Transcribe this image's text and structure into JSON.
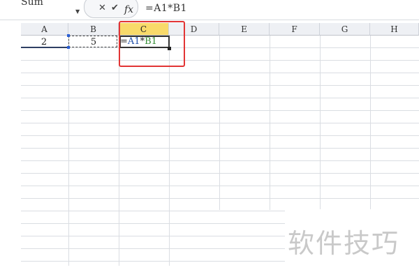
{
  "formula_bar": {
    "name_box": "Sum",
    "cancel_label": "✕",
    "enter_label": "✔",
    "fx_label": "fx",
    "formula": "=A1*B1"
  },
  "columns": [
    "A",
    "B",
    "C",
    "D",
    "E",
    "F",
    "G",
    "H"
  ],
  "active_column": "C",
  "cells": {
    "A1": "2",
    "B1": "5",
    "C1_formula_parts": [
      "=",
      "A1",
      "*",
      "B1"
    ]
  },
  "colors": {
    "ref_a1": "#1f4ea8",
    "ref_b1": "#2f8a2f",
    "highlight": "#e23434",
    "active_header": "#f8da6a"
  },
  "watermark": "软件技巧"
}
